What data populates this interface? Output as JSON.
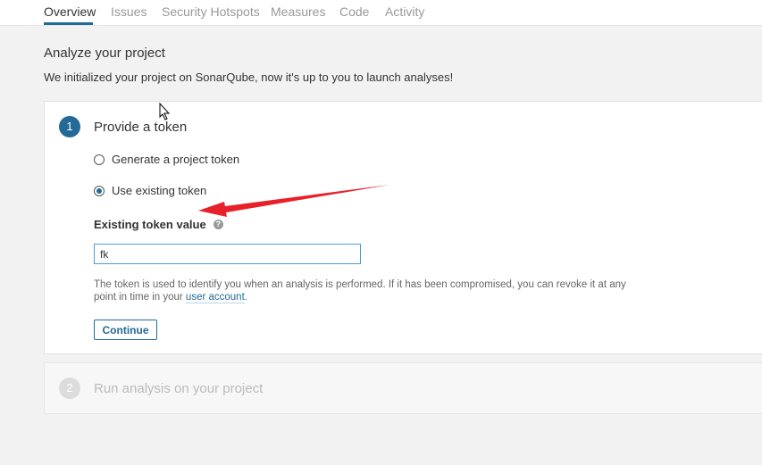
{
  "nav": {
    "tabs": [
      {
        "label": "Overview",
        "active": true
      },
      {
        "label": "Issues"
      },
      {
        "label": "Security Hotspots"
      },
      {
        "label": "Measures"
      },
      {
        "label": "Code"
      },
      {
        "label": "Activity"
      }
    ]
  },
  "page": {
    "title": "Analyze your project",
    "description": "We initialized your project on SonarQube, now it's up to you to launch analyses!"
  },
  "step1": {
    "number": "1",
    "title": "Provide a token",
    "options": [
      {
        "label": "Generate a project token",
        "checked": false
      },
      {
        "label": "Use existing token",
        "checked": true
      }
    ],
    "field_label": "Existing token value",
    "help_icon": "?",
    "input_value": "fk",
    "help_text_before": "The token is used to identify you when an analysis is performed. If it has been compromised, you can revoke it at any point in time in your ",
    "help_link": "user account",
    "help_text_after": ".",
    "continue_label": "Continue"
  },
  "step2": {
    "number": "2",
    "title": "Run analysis on your project"
  },
  "colors": {
    "accent": "#236a97",
    "annotation_arrow": "#e8202a"
  }
}
